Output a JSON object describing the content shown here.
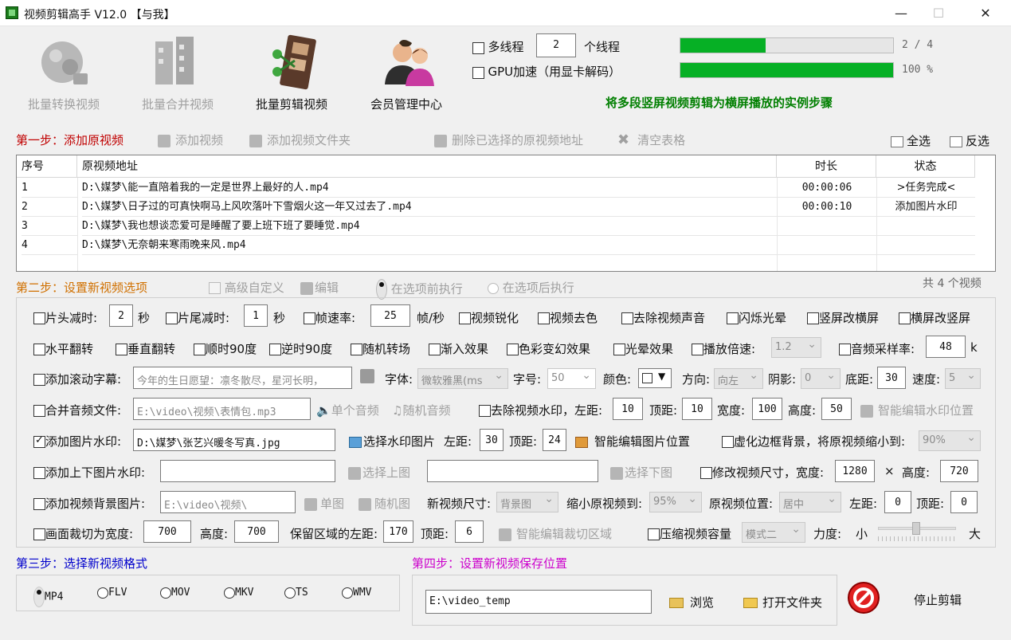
{
  "window": {
    "title": "视频剪辑高手 V12.0 【与我】",
    "minimize": "—",
    "maximize": "☐",
    "close": "✕"
  },
  "modules": [
    {
      "label": "批量转换视频",
      "icon": "convert-video-icon"
    },
    {
      "label": "批量合并视频",
      "icon": "merge-video-icon"
    },
    {
      "label": "批量剪辑视频",
      "icon": "film-edit-icon"
    },
    {
      "label": "会员管理中心",
      "icon": "members-icon"
    }
  ],
  "threading": {
    "multi_thread_label": "多线程",
    "thread_count": "2",
    "thread_unit": "个线程",
    "gpu_label": "GPU加速（用显卡解码）"
  },
  "progress": [
    {
      "value": 0.4,
      "text": "2 / 4"
    },
    {
      "value": 1.0,
      "text": "100 %"
    }
  ],
  "banner": "将多段竖屏视频剪辑为横屏播放的实例步骤",
  "step1": {
    "title": "第一步：添加原视频",
    "add_video": "添加视频",
    "add_folder": "添加视频文件夹",
    "delete_selected": "删除已选择的原视频地址",
    "clear_table": "清空表格",
    "select_all": "全选",
    "invert": "反选"
  },
  "table": {
    "headers": [
      "序号",
      "原视频地址",
      "时长",
      "状态"
    ],
    "rows": [
      {
        "no": "1",
        "path": "D:\\媒梦\\能一直陪着我的一定是世界上最好的人.mp4",
        "dur": "00:00:06",
        "status": ">任务完成<"
      },
      {
        "no": "2",
        "path": "D:\\媒梦\\日子过的可真快啊马上风吹落叶下雪烟火这一年又过去了.mp4",
        "dur": "00:00:10",
        "status": "添加图片水印"
      },
      {
        "no": "3",
        "path": "D:\\媒梦\\我也想谈恋爱可是睡醒了要上班下班了要睡觉.mp4",
        "dur": "",
        "status": ""
      },
      {
        "no": "4",
        "path": "D:\\媒梦\\无奈朝来寒雨晚来风.mp4",
        "dur": "",
        "status": ""
      }
    ]
  },
  "step2": {
    "title": "第二步：设置新视频选项",
    "advanced": "高级自定义",
    "edit": "编辑",
    "before": "在选项前执行",
    "after": "在选项后执行",
    "count": "共 4 个视频"
  },
  "row1": {
    "head_cut": "片头减时:",
    "head_val": "2",
    "sec": "秒",
    "tail_cut": "片尾减时:",
    "tail_val": "1",
    "sec2": "秒",
    "fps": "帧速率:",
    "fps_val": "25",
    "fps_unit": "帧/秒",
    "sharpen": "视频锐化",
    "decolor": "视频去色",
    "mute": "去除视频声音",
    "flash": "闪烁光晕",
    "v2h": "竖屏改横屏",
    "h2v": "横屏改竖屏"
  },
  "row2": {
    "hflip": "水平翻转",
    "vflip": "垂直翻转",
    "cw90": "顺时90度",
    "ccw90": "逆时90度",
    "rand_trans": "随机转场",
    "fade_in": "渐入效果",
    "color_fx": "色彩变幻效果",
    "halo": "光晕效果",
    "speed": "播放倍速:",
    "speed_val": "1.2",
    "sample": "音频采样率:",
    "sample_val": "48",
    "k": "k"
  },
  "row3": {
    "scroll": "添加滚动字幕:",
    "scroll_text": "今年的生日愿望：凛冬散尽，星河长明，",
    "font": "字体:",
    "font_val": "微软雅黑(ms",
    "size": "字号:",
    "size_val": "50",
    "color": "颜色:",
    "dir": "方向:",
    "dir_val": "向左",
    "shadow": "阴影:",
    "shadow_val": "0",
    "bottom": "底距:",
    "bottom_val": "30",
    "spd": "速度:",
    "spd_val": "5"
  },
  "row4": {
    "merge_audio": "合并音频文件:",
    "audio_path": "E:\\video\\视频\\表情包.mp3",
    "single": "单个音频",
    "random": "随机音频",
    "remove_wm": "去除视频水印，左距:",
    "left": "10",
    "top_lbl": "顶距:",
    "top": "10",
    "width_lbl": "宽度:",
    "width": "100",
    "height_lbl": "高度:",
    "height": "50",
    "smart": "智能编辑水印位置"
  },
  "row5": {
    "img_wm": "添加图片水印:",
    "img_path": "D:\\媒梦\\张艺兴暖冬写真.jpg",
    "choose": "选择水印图片",
    "left_lbl": "左距:",
    "left": "30",
    "top_lbl": "顶距:",
    "top": "24",
    "smart": "智能编辑图片位置",
    "virtual": "虚化边框背景，将原视频缩小到:",
    "virtual_val": "90%"
  },
  "row6": {
    "updown": "添加上下图片水印:",
    "up_btn": "选择上图",
    "down_btn": "选择下图",
    "resize": "修改视频尺寸，宽度:",
    "w": "1280",
    "x": "×",
    "h_lbl": "高度:",
    "h": "720"
  },
  "row7": {
    "bg": "添加视频背景图片:",
    "bg_path": "E:\\video\\视频\\",
    "single": "单图",
    "random": "随机图",
    "size_lbl": "新视频尺寸:",
    "size_val": "背景图",
    "shrink": "缩小原视频到:",
    "shrink_val": "95%",
    "pos": "原视频位置:",
    "pos_val": "居中",
    "left_lbl": "左距:",
    "left": "0",
    "top_lbl": "顶距:",
    "top": "0"
  },
  "row8": {
    "crop": "画面裁切为宽度:",
    "w": "700",
    "h_lbl": "高度:",
    "h": "700",
    "keep_left": "保留区域的左距:",
    "left": "170",
    "top_lbl": "顶距:",
    "top": "6",
    "smart": "智能编辑裁切区域",
    "compress": "压缩视频容量",
    "mode": "模式二",
    "force": "力度:",
    "small": "小",
    "big": "大"
  },
  "step3": {
    "title": "第三步：选择新视频格式",
    "formats": [
      "MP4",
      "FLV",
      "MOV",
      "MKV",
      "TS",
      "WMV"
    ]
  },
  "step4": {
    "title": "第四步：设置新视频保存位置",
    "path": "E:\\video_temp",
    "browse": "浏览",
    "open": "打开文件夹"
  },
  "stop": "停止剪辑",
  "colors": {
    "accent_red": "#c00000",
    "step4_magenta": "#cc00cc",
    "step3_blue": "#0000cc",
    "banner_green": "#007f00",
    "progress": "#06b025"
  }
}
